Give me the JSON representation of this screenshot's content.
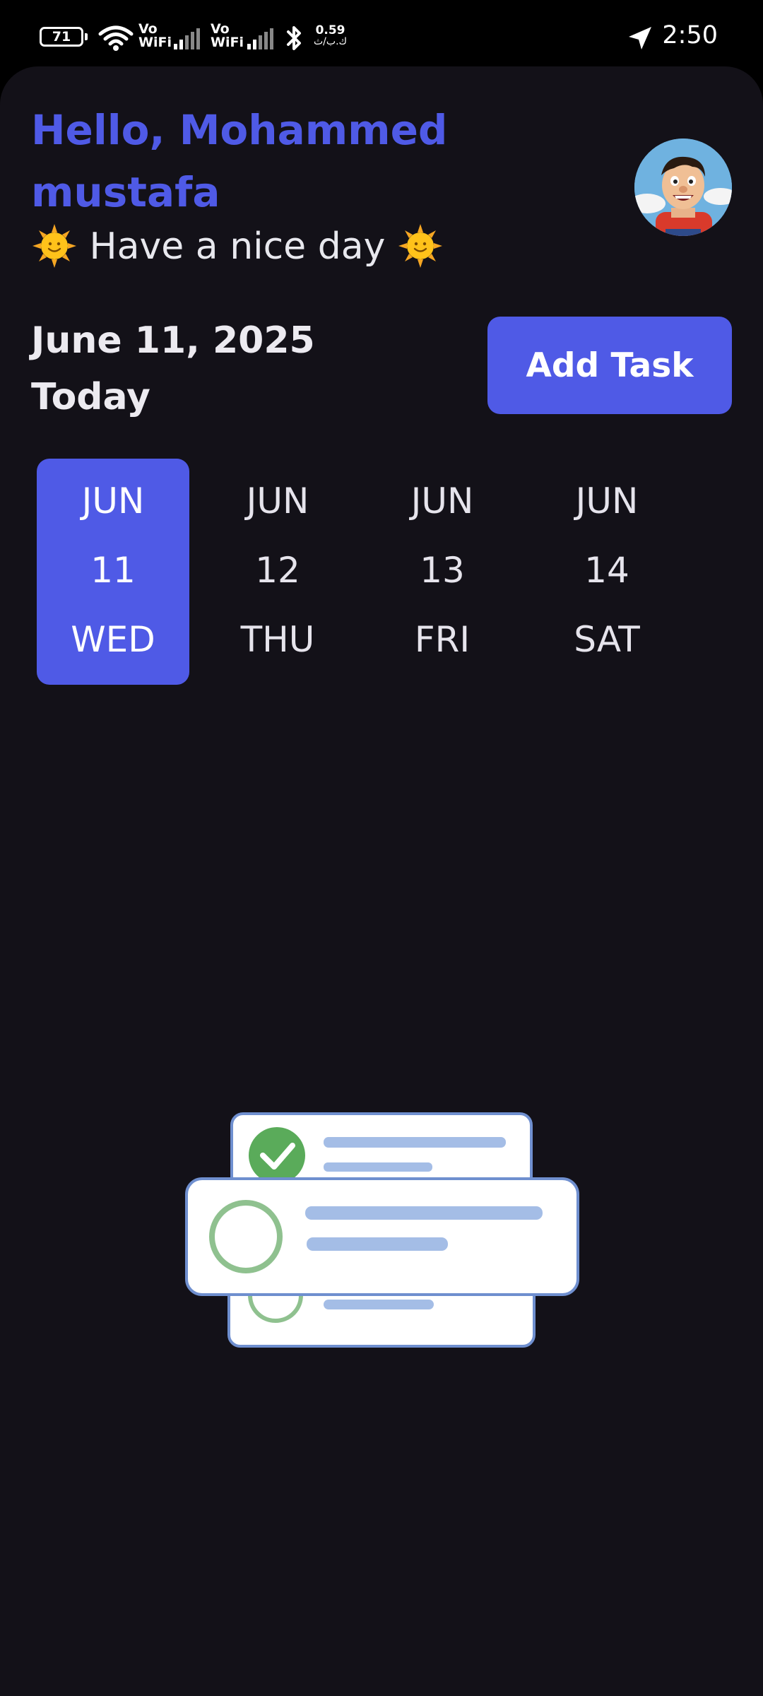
{
  "status_bar": {
    "battery": "71",
    "sim1_label": "Vo\nWiFi",
    "sim2_label": "Vo\nWiFi",
    "net_speed_value": "0.59",
    "net_speed_unit": "ك.ب/ث",
    "time": "2:50"
  },
  "header": {
    "greeting": "Hello, Mohammed mustafa",
    "subtitle": "Have a nice day",
    "avatar_icon": "user-avatar-cartoon"
  },
  "date_section": {
    "date": "June 11, 2025",
    "label": "Today",
    "add_task_label": "Add Task"
  },
  "date_strip": {
    "selected_index": 0,
    "days": [
      {
        "month": "JUN",
        "day": "11",
        "weekday": "WED"
      },
      {
        "month": "JUN",
        "day": "12",
        "weekday": "THU"
      },
      {
        "month": "JUN",
        "day": "13",
        "weekday": "FRI"
      },
      {
        "month": "JUN",
        "day": "14",
        "weekday": "SAT"
      }
    ]
  },
  "empty_state": {
    "icon": "task-list-illustration"
  },
  "colors": {
    "accent": "#4f5ae6",
    "background": "#131118",
    "text": "#e8e8ee",
    "check_green": "#5aab5a",
    "line_blue": "#a4bde6"
  }
}
